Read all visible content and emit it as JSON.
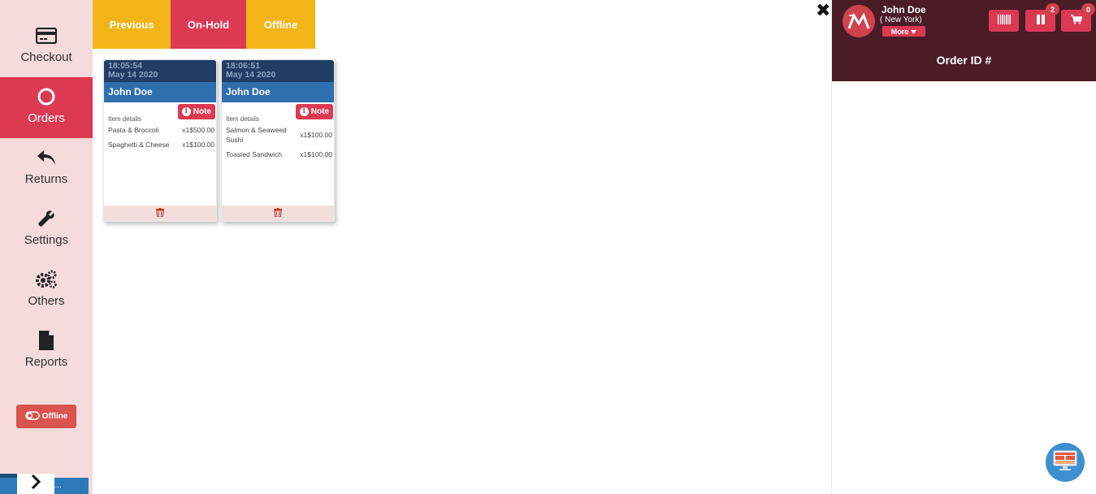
{
  "sidebar": {
    "items": [
      {
        "label": "Checkout",
        "icon": "credit-card-icon"
      },
      {
        "label": "Orders",
        "icon": "circle-icon",
        "active": true
      },
      {
        "label": "Returns",
        "icon": "reply-icon"
      },
      {
        "label": "Settings",
        "icon": "wrench-icon"
      },
      {
        "label": "Others",
        "icon": "gears-icon"
      },
      {
        "label": "Reports",
        "icon": "file-icon"
      }
    ],
    "offline_label": "Offline",
    "loading_text": "g..."
  },
  "tabs": [
    {
      "label": "Previous",
      "color": "#f2b416"
    },
    {
      "label": "On-Hold",
      "color": "#dc3a53"
    },
    {
      "label": "Offline",
      "color": "#f2b416"
    }
  ],
  "orders": [
    {
      "time": "18:05:54",
      "date": "May 14 2020",
      "customer": "John Doe",
      "note_label": "Note",
      "item_details_label": "Item details",
      "items": [
        {
          "name": "Pasta & Broccoli",
          "qty_price": "x1$500.00"
        },
        {
          "name": "Spaghetti & Cheese",
          "qty_price": "x1$100.00"
        }
      ]
    },
    {
      "time": "18:06:51",
      "date": "May 14 2020",
      "customer": "John Doe",
      "note_label": "Note",
      "item_details_label": "Item details",
      "items": [
        {
          "name": "Salmon & Seaweed Sushi",
          "qty_price": "x1$100.00"
        },
        {
          "name": "Toasted Sandwich",
          "qty_price": "x1$100.00"
        }
      ]
    }
  ],
  "header": {
    "user_name": "John Doe",
    "user_location": "( New York)",
    "more_label": "More",
    "hold_count": "2",
    "cart_count": "0",
    "order_id_label": "Order ID #"
  },
  "colors": {
    "sidebar_bg": "#f5dbdc",
    "accent_red": "#dc3a53",
    "accent_yellow": "#f2b416",
    "header_bg": "#4a1c26",
    "card_head": "#223d63",
    "card_name": "#2f6fae"
  }
}
